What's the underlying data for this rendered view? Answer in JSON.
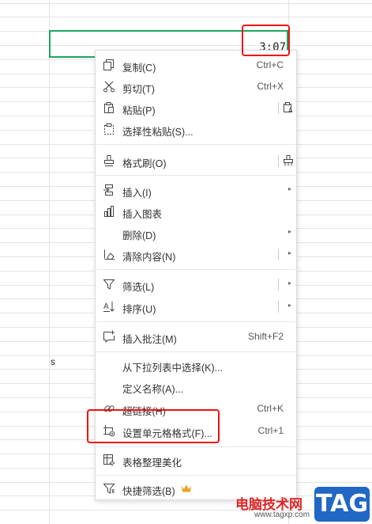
{
  "cell": {
    "value": "3:07",
    "text_s": "s"
  },
  "menu": {
    "items": [
      {
        "label": "复制(C)",
        "shortcut": "Ctrl+C",
        "icon": "copy-icon"
      },
      {
        "label": "剪切(T)",
        "shortcut": "Ctrl+X",
        "icon": "scissors-icon"
      },
      {
        "label": "粘贴(P)",
        "shortcut": "",
        "icon": "paste-icon"
      },
      {
        "label": "选择性粘贴(S)...",
        "shortcut": "",
        "icon": "paste-special-icon"
      },
      {
        "label": "格式刷(O)",
        "shortcut": "",
        "icon": "format-painter-icon"
      },
      {
        "label": "插入(I)",
        "shortcut": "",
        "icon": "insert-icon"
      },
      {
        "label": "插入图表",
        "shortcut": "",
        "icon": "chart-icon"
      },
      {
        "label": "删除(D)",
        "shortcut": "",
        "icon": ""
      },
      {
        "label": "清除内容(N)",
        "shortcut": "",
        "icon": "eraser-icon"
      },
      {
        "label": "筛选(L)",
        "shortcut": "",
        "icon": "filter-icon"
      },
      {
        "label": "排序(U)",
        "shortcut": "",
        "icon": "sort-icon"
      },
      {
        "label": "插入批注(M)",
        "shortcut": "Shift+F2",
        "icon": "comment-icon"
      },
      {
        "label": "从下拉列表中选择(K)...",
        "shortcut": "",
        "icon": ""
      },
      {
        "label": "定义名称(A)...",
        "shortcut": "",
        "icon": ""
      },
      {
        "label": "超链接(H)",
        "shortcut": "Ctrl+K",
        "icon": "link-icon"
      },
      {
        "label": "设置单元格格式(F)...",
        "shortcut": "Ctrl+1",
        "icon": "format-cells-icon"
      },
      {
        "label": "表格整理美化",
        "shortcut": "",
        "icon": "table-beautify-icon"
      },
      {
        "label": "快捷筛选(B)",
        "shortcut": "",
        "icon": "quick-filter-icon"
      }
    ]
  },
  "watermark": {
    "tag": "TAG",
    "cn": "电脑技术网",
    "url": "www.tagxp.com"
  },
  "colors": {
    "selection": "#1fa463",
    "highlight": "#e11111",
    "crown": "#f0a020"
  }
}
